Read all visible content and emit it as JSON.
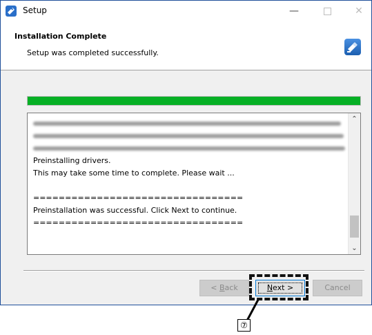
{
  "window": {
    "title": "Setup",
    "controls": {
      "minimize": "—",
      "close": "✕"
    }
  },
  "header": {
    "title": "Installation Complete",
    "subtitle": "Setup was completed successfully.",
    "icon": "usb-driver-installer-icon"
  },
  "progress": {
    "fraction": 1.0,
    "color": "#06b025"
  },
  "log": {
    "lines": [
      "Preinstalling drivers.",
      "This may take some time to complete. Please wait ...",
      "",
      "=================================",
      "Preinstallation was successful. Click Next to continue.",
      "================================="
    ]
  },
  "buttons": {
    "back": {
      "prefix": "< ",
      "accel": "B",
      "rest": "ack"
    },
    "next": {
      "accel": "N",
      "rest": "ext >"
    },
    "cancel": "Cancel"
  },
  "annotation": {
    "callout": "⑦"
  },
  "colors": {
    "accent": "#0078d7",
    "titlebar_border": "#1e4f9a"
  }
}
